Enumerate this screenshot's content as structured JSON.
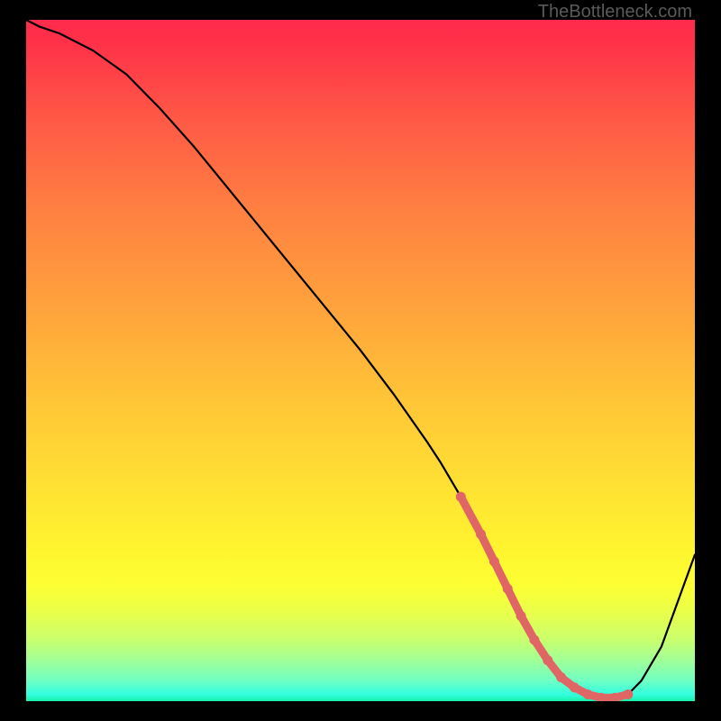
{
  "watermark": "TheBottleneck.com",
  "colors": {
    "background": "#000000",
    "curve": "#000000",
    "marker": "#e06666",
    "gradient_top": "#ff2b4c",
    "gradient_bottom": "#18f0a8"
  },
  "chart_data": {
    "type": "line",
    "title": "",
    "xlabel": "",
    "ylabel": "",
    "xlim": [
      0,
      100
    ],
    "ylim": [
      0,
      100
    ],
    "x": [
      0,
      2,
      5,
      10,
      15,
      20,
      25,
      30,
      35,
      40,
      45,
      50,
      55,
      60,
      62,
      65,
      68,
      70,
      72,
      74,
      76,
      78,
      80,
      82,
      84,
      86,
      88,
      90,
      92,
      95,
      100
    ],
    "values": [
      100,
      99,
      98,
      95.5,
      92,
      87,
      81.5,
      75.5,
      69.5,
      63.5,
      57.5,
      51.5,
      45,
      38,
      35,
      30,
      24.5,
      20.5,
      16.5,
      12.5,
      9,
      6,
      3.5,
      2,
      1,
      0.5,
      0.5,
      1,
      3,
      8,
      21.5
    ],
    "markers": {
      "x": [
        65,
        68,
        70,
        72,
        74,
        76,
        78,
        80,
        82,
        84,
        86,
        88,
        90
      ],
      "y": [
        30,
        24.5,
        20.5,
        16.5,
        12.5,
        9,
        6,
        3.5,
        2,
        1,
        0.5,
        0.5,
        1
      ]
    }
  }
}
